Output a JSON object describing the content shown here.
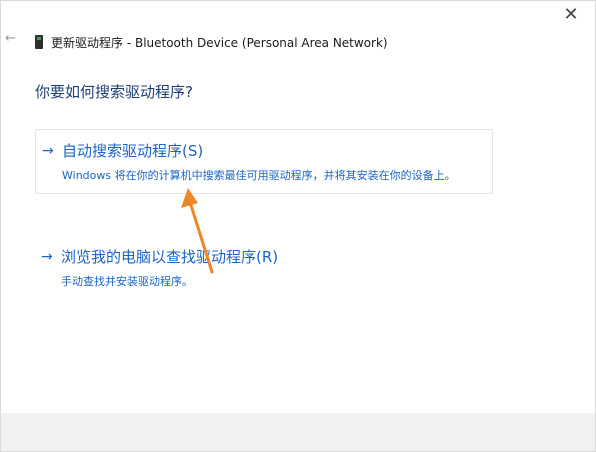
{
  "window": {
    "close_label": "✕",
    "back_label": "←",
    "title": "更新驱动程序 - Bluetooth Device (Personal Area Network)"
  },
  "question": "你要如何搜索驱动程序?",
  "options": [
    {
      "arrow": "→",
      "title": "自动搜索驱动程序(S)",
      "description": "Windows 将在你的计算机中搜索最佳可用驱动程序，并将其安装在你的设备上。"
    },
    {
      "arrow": "→",
      "title": "浏览我的电脑以查找驱动程序(R)",
      "description": "手动查找并安装驱动程序。"
    }
  ],
  "colors": {
    "link_blue": "#1b64c8",
    "heading_blue": "#1e3f76",
    "annotation_orange": "#f0862a"
  }
}
